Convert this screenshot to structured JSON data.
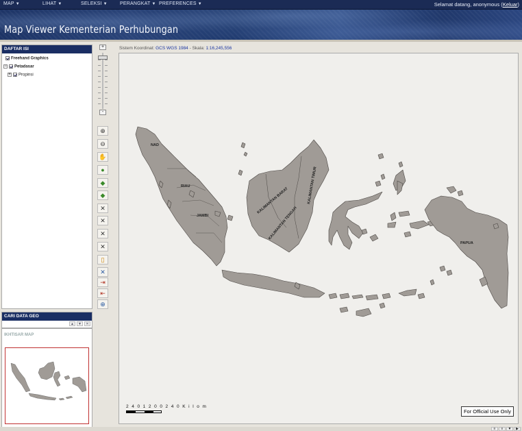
{
  "menu": {
    "items": [
      {
        "label": "MAP"
      },
      {
        "label": "LIHAT"
      },
      {
        "label": "SELEKSI"
      },
      {
        "label": "PERANGKAT"
      },
      {
        "label": "PREFERENCES"
      }
    ],
    "caret": "▼",
    "welcome_text": "Selamat datang, anonymous (",
    "logout_label": "Keluar",
    "welcome_close": ")"
  },
  "app": {
    "title": "Map Viewer Kementerian Perhubungan"
  },
  "toc": {
    "header": "DAFTAR ISI",
    "items": [
      {
        "label": "Freehand Graphics"
      },
      {
        "label": "Petadasar"
      },
      {
        "label": "Propinsi"
      }
    ]
  },
  "search": {
    "header": "CARI DATA GEO",
    "controls": [
      "▲",
      "▼",
      "✕"
    ]
  },
  "overview": {
    "label": "IKHTISAR MAP"
  },
  "map": {
    "coord_label": "Sistem Koordinat: ",
    "coord_value": "GCS WGS 1984",
    "scale_label": " - Skala: ",
    "scale_value": "1:16,245,556",
    "scalebar_label": "2 4 0 1 2 0   0       2 4 0   K i l o m",
    "official_label": "For Official Use Only",
    "region_labels": {
      "nad": "NAD",
      "riau": "RIAU",
      "jambi": "JAMBI",
      "kalbar": "KALIMANTAN BARAT",
      "kalteng": "KALIMANTAN TENGAH",
      "kaltim": "KALIMANTAN TIMUR",
      "papua": "PAPUA"
    }
  },
  "zoom": {
    "in_label": "+",
    "out_label": "-"
  },
  "tools": [
    "⊕",
    "⊖",
    "✋",
    "●",
    "◆",
    "◆",
    "✕",
    "✕",
    "✕",
    "✕",
    "▯",
    "✕",
    "⇥",
    "⇤",
    "⊕"
  ],
  "bottom_controls": [
    "≡",
    "≡",
    "▼",
    "▶"
  ],
  "colors": {
    "menubar": "#1b2b55",
    "panel_header": "#1a2e63",
    "land": "#a09b96",
    "overview_frame": "#c03030"
  }
}
